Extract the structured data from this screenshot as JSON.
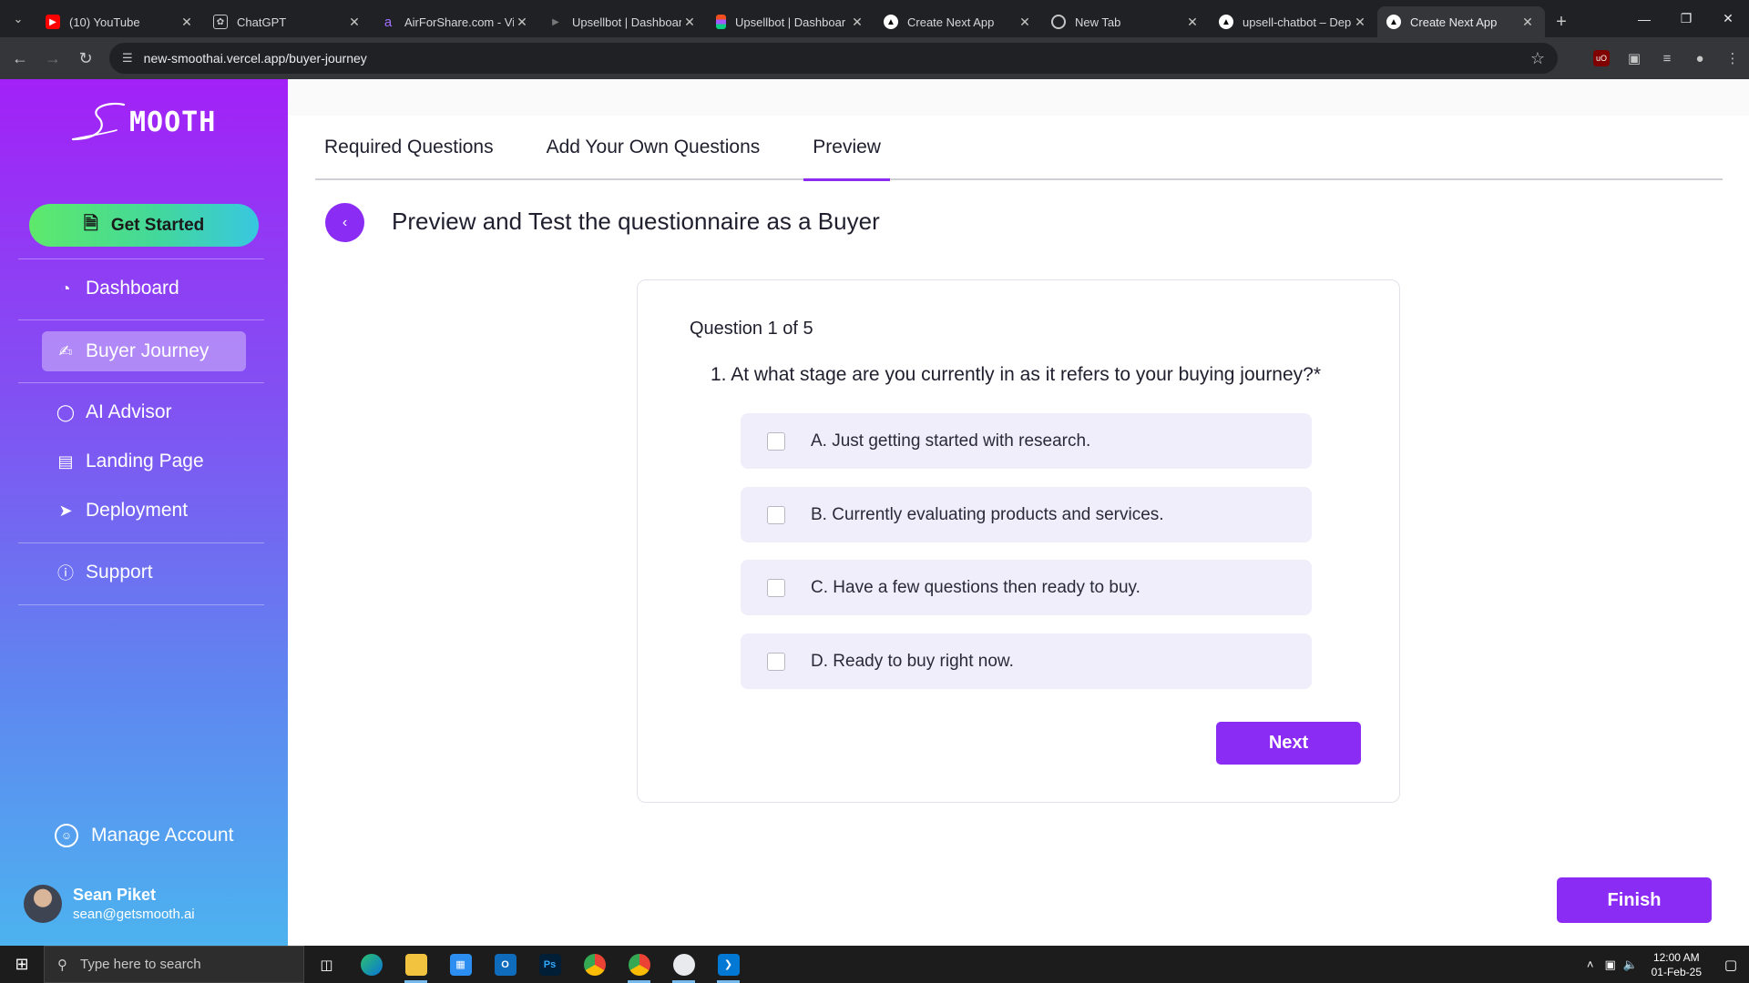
{
  "browser": {
    "tabs": [
      {
        "title": "(10) YouTube",
        "icon": "youtube-icon",
        "color": "#ff0000"
      },
      {
        "title": "ChatGPT",
        "icon": "chatgpt-icon",
        "color": "#5f6368"
      },
      {
        "title": "AirForShare.com - Vir",
        "icon": "airforshare-icon",
        "color": "#7b4bf5"
      },
      {
        "title": "Upsellbot | Dashboar",
        "icon": "upsellbot-icon",
        "color": "#444"
      },
      {
        "title": "Upsellbot | Dashboar",
        "icon": "figma-icon",
        "color": "#f24e1e"
      },
      {
        "title": "Create Next App",
        "icon": "vercel-icon",
        "color": "#000"
      },
      {
        "title": "New Tab",
        "icon": "chrome-icon",
        "color": "#5f6368"
      },
      {
        "title": "upsell-chatbot – Dep",
        "icon": "vercel-icon",
        "color": "#000"
      },
      {
        "title": "Create Next App",
        "icon": "vercel-icon",
        "color": "#000"
      }
    ],
    "active_tab": 8,
    "url": "new-smoothai.vercel.app/buyer-journey"
  },
  "sidebar": {
    "logo_text": "MOOTH",
    "get_started": "Get Started",
    "items": [
      {
        "label": "Dashboard",
        "icon": "pie-chart-icon"
      },
      {
        "label": "Buyer Journey",
        "icon": "handshake-icon"
      },
      {
        "label": "AI Advisor",
        "icon": "chat-bubble-icon"
      },
      {
        "label": "Landing Page",
        "icon": "layout-icon"
      },
      {
        "label": "Deployment",
        "icon": "rocket-icon"
      },
      {
        "label": "Support",
        "icon": "help-circle-icon"
      }
    ],
    "active_item": "Buyer Journey",
    "manage_account": "Manage Account",
    "user": {
      "name": "Sean Piket",
      "email": "sean@getsmooth.ai"
    }
  },
  "main": {
    "tabs": [
      {
        "label": "Required Questions"
      },
      {
        "label": "Add Your Own Questions"
      },
      {
        "label": "Preview"
      }
    ],
    "active_tab": "Preview",
    "title": "Preview and Test the questionnaire as a Buyer",
    "question": {
      "counter": "Question 1 of 5",
      "text": "1. At what stage are you currently in as it refers to your buying journey?*",
      "options": [
        {
          "label": "A. Just getting started with research.",
          "checked": false
        },
        {
          "label": "B. Currently evaluating products and services.",
          "checked": false
        },
        {
          "label": "C. Have a few questions then ready to buy.",
          "checked": false
        },
        {
          "label": "D. Ready to buy right now.",
          "checked": false
        }
      ]
    },
    "next_label": "Next",
    "finish_label": "Finish"
  },
  "taskbar": {
    "search_placeholder": "Type here to search",
    "time": "12:00 AM",
    "date": "01-Feb-25"
  },
  "colors": {
    "accent": "#8b2cf5",
    "option_bg": "#f0eefb",
    "sidebar_top": "#a221f7",
    "sidebar_bottom": "#4cb3ef",
    "get_started_start": "#5ee96b",
    "get_started_end": "#38c7e0"
  }
}
